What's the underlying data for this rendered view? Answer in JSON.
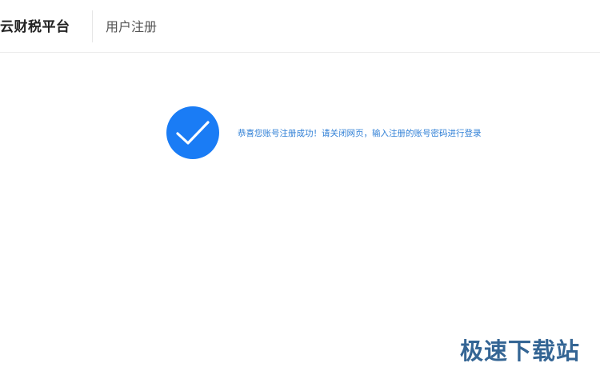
{
  "header": {
    "brand": "云财税平台",
    "page_title": "用户注册"
  },
  "result": {
    "icon": "check-circle-icon",
    "message": "恭喜您账号注册成功！请关闭网页，输入注册的账号密码进行登录"
  },
  "watermark": {
    "text": "极速下载站"
  },
  "colors": {
    "accent": "#1a7cf5",
    "message_text": "#2f7fd6",
    "brand_text": "#222222",
    "title_text": "#555555"
  }
}
